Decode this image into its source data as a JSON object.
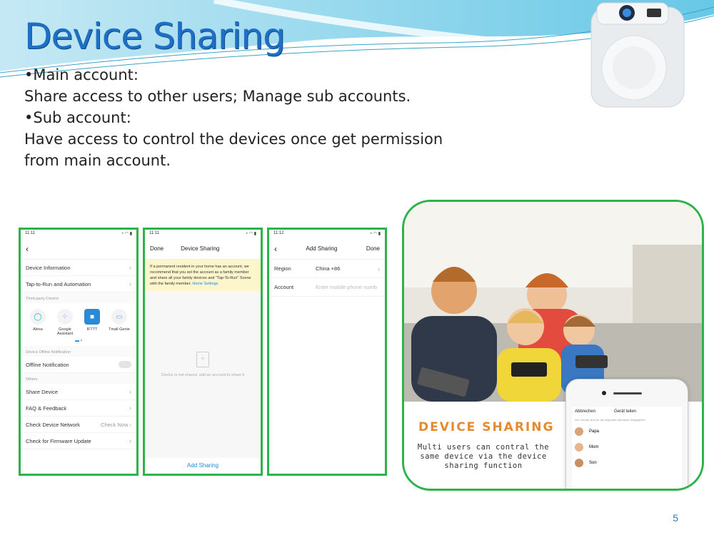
{
  "title": "Device Sharing",
  "body": {
    "bullet1": "Main account:",
    "line1": "Share access to other users; Manage sub accounts.",
    "bullet2": "Sub account:",
    "line2": "Have access to control the devices once get permission from main account."
  },
  "phone1": {
    "status_time": "11:11",
    "rows": [
      "Device Information",
      "Tap-to-Run and Automation"
    ],
    "third_party_label": "Third-party Control",
    "third_party": [
      "Alexa",
      "Google Assistant",
      "IFTTT",
      "Tmall Genie"
    ],
    "offline_label": "Device Offline Notification",
    "offline_row": "Offline Notification",
    "others_label": "Others",
    "other_rows": [
      "Share Device",
      "FAQ & Feedback",
      "Check Device Network",
      "Check for Firmware Update"
    ],
    "check_now": "Check Now"
  },
  "phone2": {
    "status_time": "11:11",
    "done": "Done",
    "title": "Device Sharing",
    "notice": "If a permanent resident in your home has an account, we recommend that you set the account as a family member and share all your family devices and \"Tap-To-Run\" Scene with the family member.",
    "notice_link": "Home Settings",
    "empty": "Device is not shared, add an account to share it",
    "add": "Add Sharing"
  },
  "phone3": {
    "status_time": "11:12",
    "title": "Add Sharing",
    "done": "Done",
    "region_label": "Region",
    "region_value": "China +86",
    "account_label": "Account",
    "account_placeholder": "Enter mobile phone numb"
  },
  "photo": {
    "headline": "DEVICE SHARING",
    "caption": "Multi users can contral the same device via the device sharing function",
    "mini_left": "Abbrechen",
    "mini_title": "Gerät teilen",
    "mini_sub": "Ihre Geräte sind für die folgenden Benutzer freigegeben",
    "contacts": [
      "Papa",
      "Mom",
      "Son"
    ]
  },
  "page_number": "5"
}
